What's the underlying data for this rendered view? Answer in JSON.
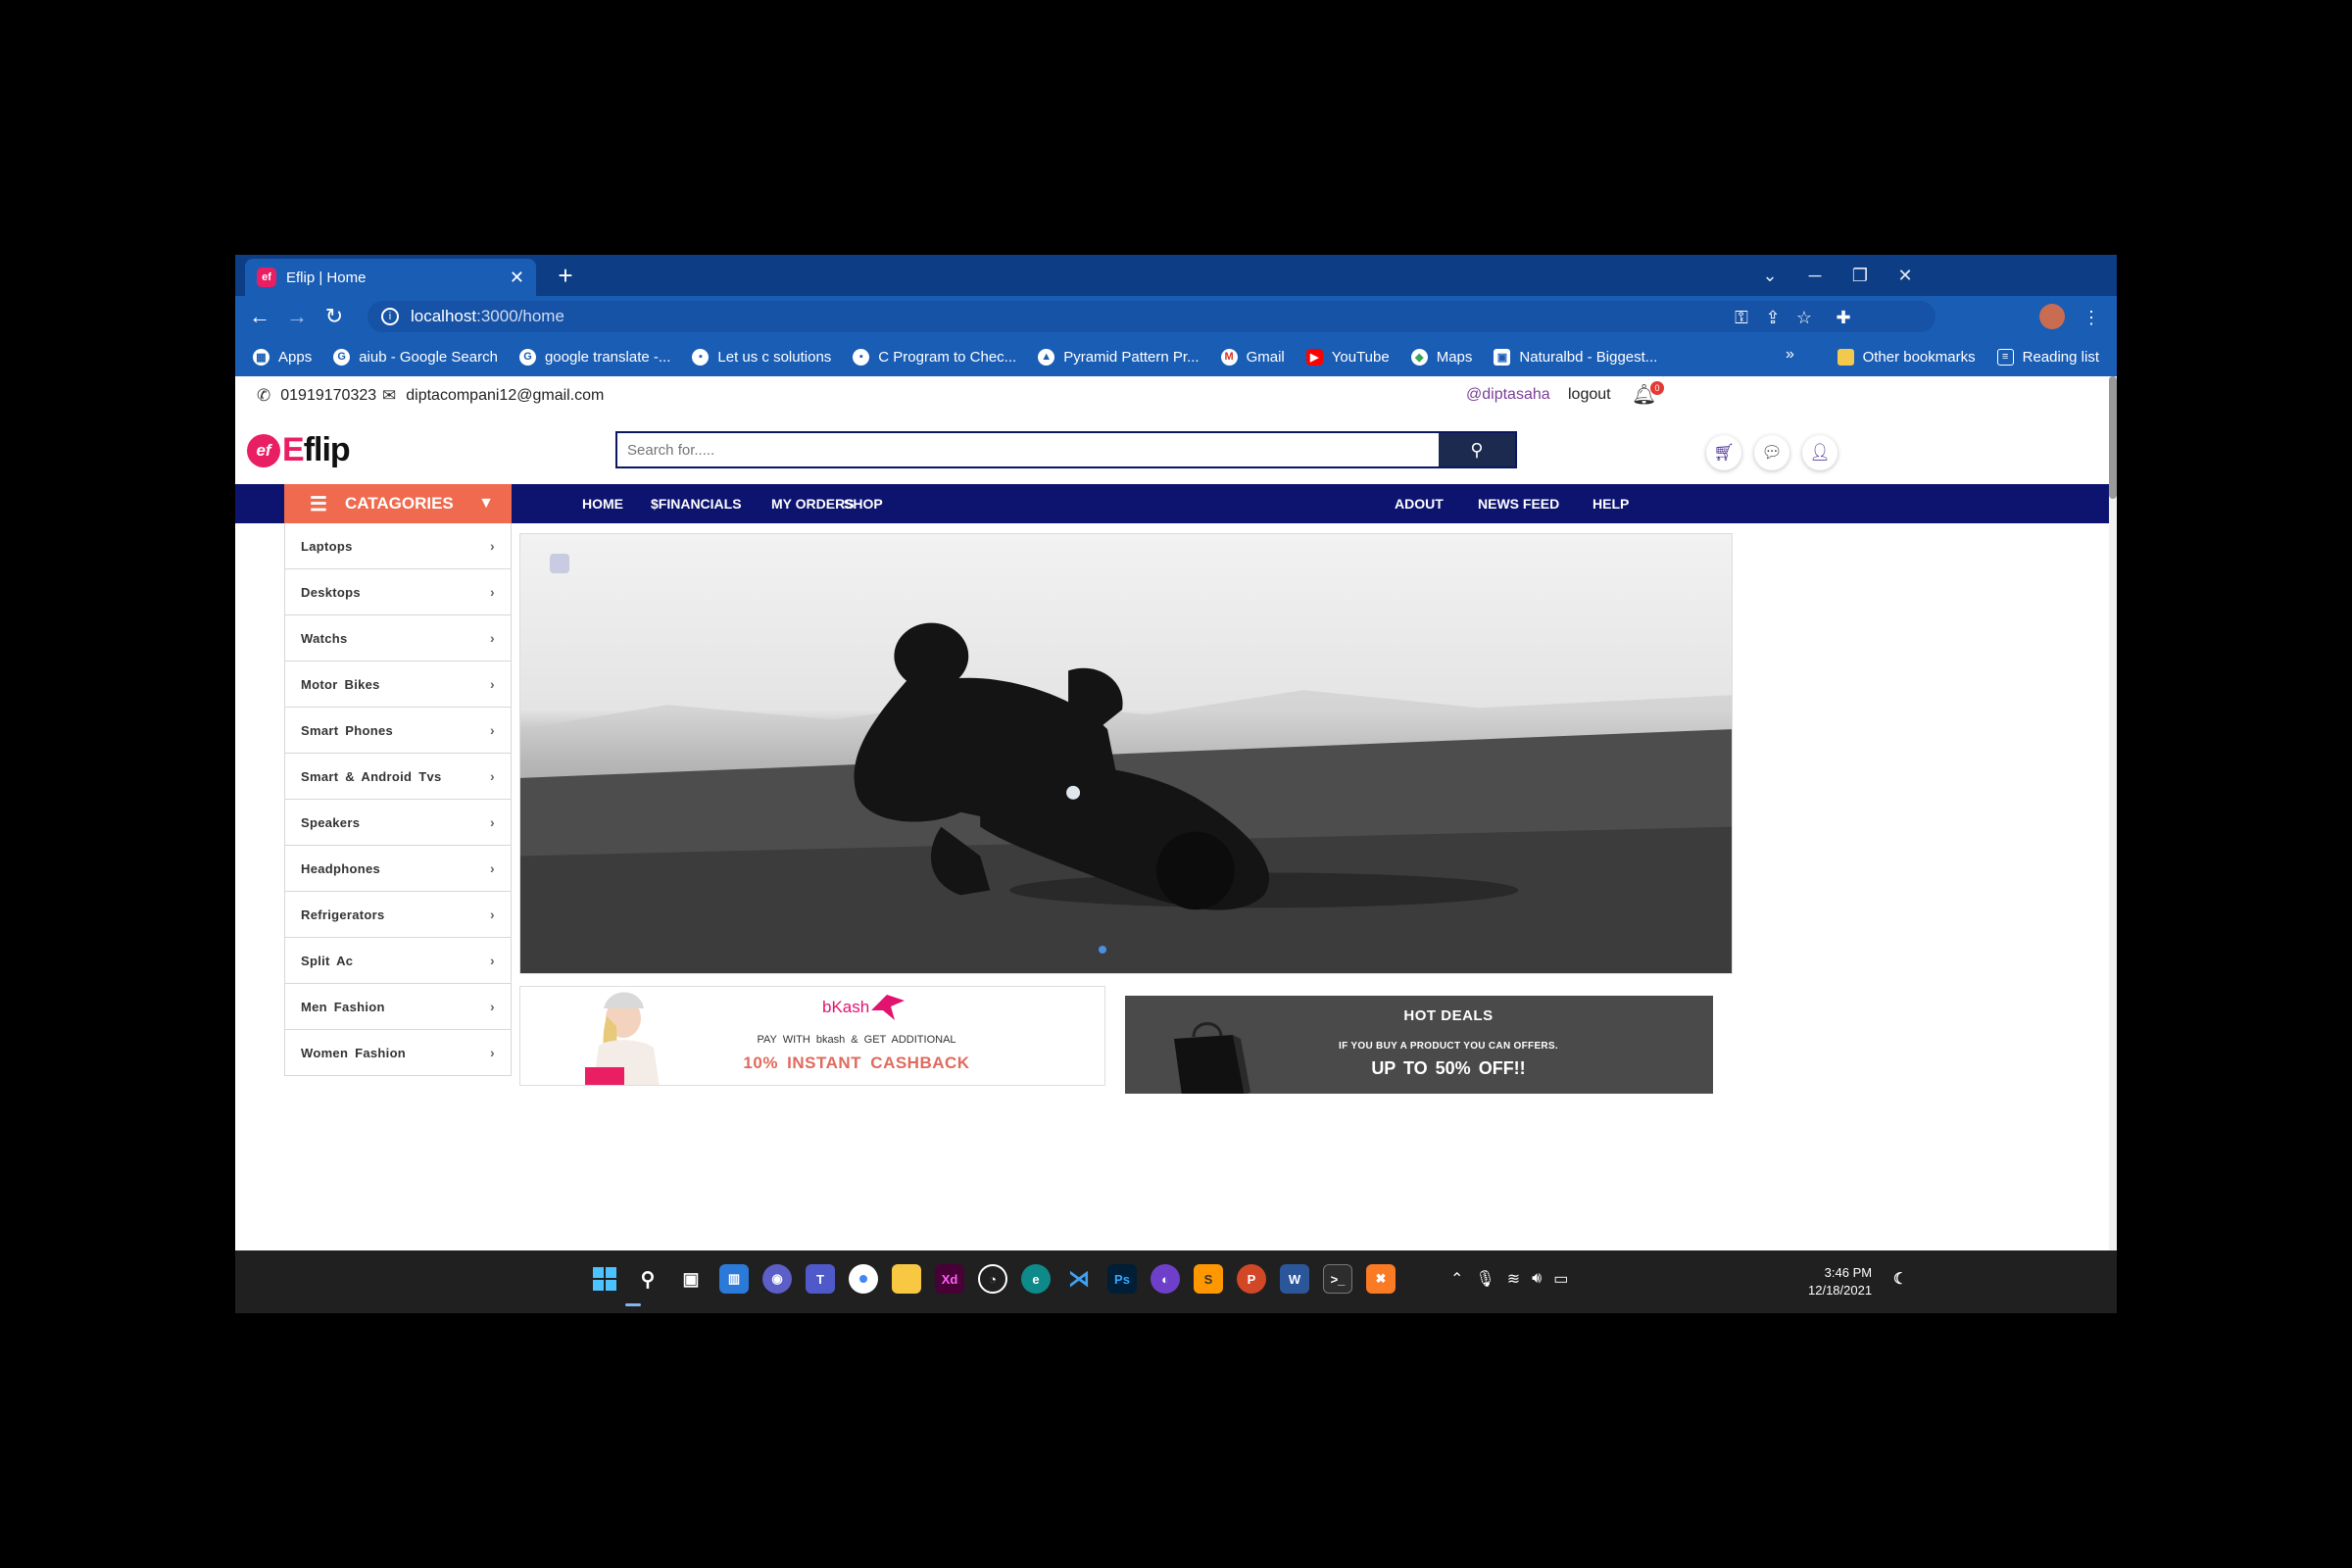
{
  "browser": {
    "tab_title": "Eflip | Home",
    "favicon": "ef",
    "url_host": "localhost",
    "url_path": ":3000/home",
    "bookmarks": [
      {
        "label": "Apps",
        "icon": "apps-grid-icon"
      },
      {
        "label": "aiub - Google Search",
        "icon": "google-icon"
      },
      {
        "label": "google translate -...",
        "icon": "google-icon"
      },
      {
        "label": "Let us c solutions",
        "icon": "page-icon"
      },
      {
        "label": "C Program to Chec...",
        "icon": "page-icon"
      },
      {
        "label": "Pyramid Pattern Pr...",
        "icon": "page-icon"
      },
      {
        "label": "Gmail",
        "icon": "gmail-icon"
      },
      {
        "label": "YouTube",
        "icon": "youtube-icon"
      },
      {
        "label": "Maps",
        "icon": "maps-icon"
      },
      {
        "label": "Naturalbd - Biggest...",
        "icon": "page-icon"
      }
    ],
    "other_bookmarks": "Other bookmarks",
    "reading_list": "Reading list"
  },
  "topinfo": {
    "phone": "01919170323",
    "email": "diptacompani12@gmail.com",
    "user": "@diptasaha",
    "logout": "logout",
    "notification_count": "0"
  },
  "logo": {
    "mark": "ef",
    "first": "E",
    "rest": "flip"
  },
  "search": {
    "placeholder": "Search for....."
  },
  "nav": {
    "categories_label": "CATAGORIES",
    "links_left": [
      "HOME",
      "$FINANCIALS",
      "MY ORDERS",
      "SHOP"
    ],
    "links_right": [
      "ADOUT",
      "NEWS FEED",
      "HELP"
    ]
  },
  "categories": [
    "Laptops",
    "Desktops",
    "Watchs",
    "Motor Bikes",
    "Smart Phones",
    "Smart & Android Tvs",
    "Speakers",
    "Headphones",
    "Refrigerators",
    "Split Ac",
    "Men Fashion",
    "Women Fashion"
  ],
  "bkash_promo": {
    "brand": "bKash",
    "line1": "PAY WITH bkash & GET ADDITIONAL",
    "line2": "10% INSTANT CASHBACK"
  },
  "hot_deals": {
    "title": "HOT DEALS",
    "line1": "IF YOU BUY A PRODUCT YOU CAN OFFERS.",
    "line2": "UP TO 50% OFF!!"
  },
  "taskbar": {
    "time": "3:46 PM",
    "date": "12/18/2021"
  },
  "colors": {
    "nav_bg": "#0d1470",
    "categories_bg": "#ef6a4e",
    "brand_pink": "#e91e63",
    "browser_blue": "#1a5db5"
  }
}
